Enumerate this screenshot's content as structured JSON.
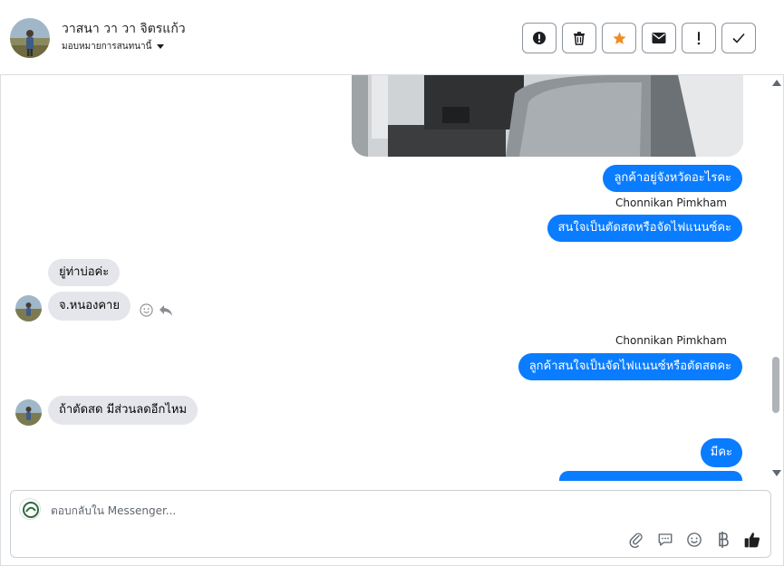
{
  "header": {
    "customer_name": "วาสนา วา วา จิตรแก้ว",
    "assign_label": "มอบหมายการสนทนานี้",
    "actions": [
      {
        "name": "report-spam-button",
        "icon": "exclamation-circle-icon"
      },
      {
        "name": "delete-button",
        "icon": "trash-icon"
      },
      {
        "name": "star-button",
        "icon": "star-icon"
      },
      {
        "name": "mark-unread-button",
        "icon": "envelope-icon"
      },
      {
        "name": "follow-up-button",
        "icon": "exclamation-icon"
      },
      {
        "name": "mark-done-button",
        "icon": "check-icon"
      }
    ]
  },
  "thread": {
    "messages": [
      {
        "id": "m1",
        "direction": "out",
        "text": "ลูกค้าอยู่จังหวัดอะไรคะ"
      },
      {
        "id": "s1",
        "sender": "Chonnikan Pimkham"
      },
      {
        "id": "m2",
        "direction": "out",
        "text": "สนใจเป็นตัดสดหรือจัดไฟแนนซ์คะ"
      },
      {
        "id": "m3",
        "direction": "in",
        "text": "ยู่ท่าบ่อค่ะ"
      },
      {
        "id": "m4",
        "direction": "in",
        "text": "จ.หนองคาย"
      },
      {
        "id": "s2",
        "sender": "Chonnikan Pimkham"
      },
      {
        "id": "m5",
        "direction": "out",
        "text": "ลูกค้าสนใจเป็นจัดไฟแนนซ์หรือตัดสดคะ"
      },
      {
        "id": "m6",
        "direction": "in",
        "text": "ถ้าตัดสด มีส่วนลดอีกไหม"
      },
      {
        "id": "m7",
        "direction": "out",
        "text": "มีคะ"
      }
    ]
  },
  "composer": {
    "placeholder": "ตอบกลับใน Messenger...",
    "tools": [
      "paperclip-icon",
      "saved-reply-icon",
      "emoji-icon",
      "baht-icon",
      "thumbs-up-icon"
    ]
  },
  "colors": {
    "outgoing_bubble": "#0a7cff",
    "incoming_bubble": "#e4e6eb",
    "star": "#f28b24"
  }
}
